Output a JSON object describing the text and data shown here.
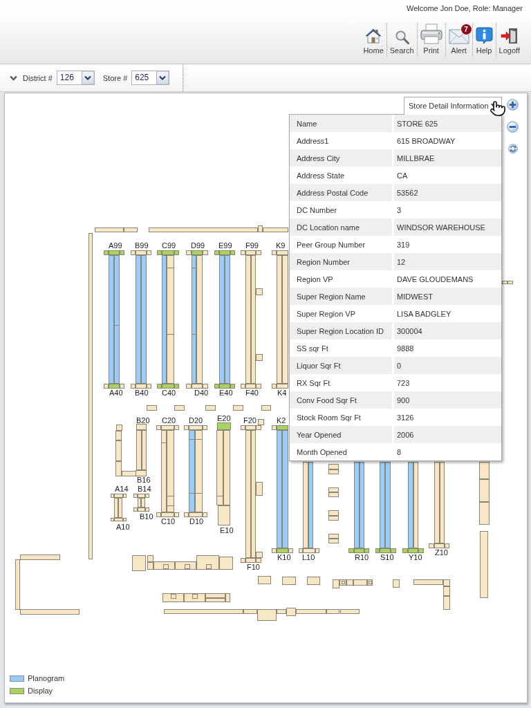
{
  "header": {
    "welcome": "Welcome Jon Doe, Role: Manager"
  },
  "toolbar": [
    {
      "kind": "home",
      "label": "Home"
    },
    {
      "kind": "search",
      "label": "Search"
    },
    {
      "kind": "print",
      "label": "Print"
    },
    {
      "kind": "alert",
      "label": "Alert",
      "badge": "7"
    },
    {
      "kind": "help",
      "label": "Help"
    },
    {
      "kind": "logoff",
      "label": "Logoff"
    }
  ],
  "filters": [
    {
      "label": "District #",
      "value": "126"
    },
    {
      "label": "Store #",
      "value": "625"
    }
  ],
  "details": {
    "tab": "Store Detail Information",
    "rows": [
      {
        "label": "Name",
        "value": "STORE 625"
      },
      {
        "label": "Address1",
        "value": "615 BROADWAY"
      },
      {
        "label": "Address City",
        "value": "MILLBRAE"
      },
      {
        "label": "Address State",
        "value": "CA"
      },
      {
        "label": "Address Postal Code",
        "value": "53562"
      },
      {
        "label": "DC Number",
        "value": "3"
      },
      {
        "label": "DC Location name",
        "value": "WINDSOR WAREHOUSE"
      },
      {
        "label": "Peer Group Number",
        "value": "319"
      },
      {
        "label": "Region Number",
        "value": "12"
      },
      {
        "label": "Region VP",
        "value": "DAVE GLOUDEMANS"
      },
      {
        "label": "Super Region Name",
        "value": "MIDWEST"
      },
      {
        "label": "Super Region VP",
        "value": "LISA BADGLEY"
      },
      {
        "label": "Super Region Location ID",
        "value": "300004"
      },
      {
        "label": "SS sqr Ft",
        "value": "9888"
      },
      {
        "label": "Liquor Sqr Ft",
        "value": "0"
      },
      {
        "label": "RX Sqr Ft",
        "value": "723"
      },
      {
        "label": "Conv Food Sqr Ft",
        "value": "900"
      },
      {
        "label": "Stock Room Sqr Ft",
        "value": "3126"
      },
      {
        "label": "Year Opened",
        "value": "2006"
      },
      {
        "label": "Month Opened",
        "value": "8"
      }
    ]
  },
  "floor_plan": {
    "aisles": [
      {
        "top_label": "A99",
        "bottom_label": "A40",
        "top_cap": [
          {
            "kind": "display"
          },
          {
            "kind": "display"
          },
          {
            "kind": "display"
          }
        ],
        "shelves": [
          {
            "kind": "planogram"
          },
          {
            "kind": "planogram"
          }
        ],
        "bottom_cap": [
          {
            "kind": "plain"
          },
          {
            "kind": "display"
          },
          {
            "kind": "plain"
          }
        ]
      },
      {
        "top_label": "B99",
        "bottom_label": "B40",
        "top_cap": [
          {
            "kind": "plain"
          },
          {
            "kind": "plain"
          },
          {
            "kind": "plain"
          }
        ],
        "shelves": [
          {
            "kind": "planogram"
          },
          {
            "kind": "planogram"
          }
        ],
        "bottom_cap": [
          {
            "kind": "plain"
          },
          {
            "kind": "plain"
          },
          {
            "kind": "plain"
          }
        ]
      },
      {
        "top_label": "C99",
        "bottom_label": "C40",
        "top_cap": [
          {
            "kind": "display"
          },
          {
            "kind": "display"
          },
          {
            "kind": "display"
          }
        ],
        "shelves": [
          {
            "kind": "planogram"
          },
          {
            "kind": "plain"
          }
        ],
        "bottom_cap": [
          {
            "kind": "display"
          },
          {
            "kind": "display"
          },
          {
            "kind": "display"
          }
        ]
      },
      {
        "top_label": "D99",
        "bottom_label": "D40",
        "top_cap": [
          {
            "kind": "plain"
          },
          {
            "kind": "display"
          },
          {
            "kind": "plain"
          }
        ],
        "shelves": [
          {
            "kind": "planogram"
          },
          {
            "kind": "plain"
          }
        ],
        "bottom_cap": [
          {
            "kind": "plain"
          },
          {
            "kind": "plain"
          },
          {
            "kind": "plain"
          }
        ]
      },
      {
        "top_label": "E99",
        "bottom_label": "E40",
        "top_cap": [
          {
            "kind": "display"
          },
          {
            "kind": "display"
          },
          {
            "kind": "display"
          }
        ],
        "shelves": [
          {
            "kind": "planogram"
          },
          {
            "kind": "planogram"
          }
        ],
        "bottom_cap": [
          {
            "kind": "display"
          },
          {
            "kind": "display"
          },
          {
            "kind": "display"
          }
        ]
      },
      {
        "top_label": "F99",
        "bottom_label": "F40",
        "top_cap": [
          {
            "kind": "plain"
          },
          {
            "kind": "plain"
          },
          {
            "kind": "plain"
          }
        ],
        "shelves": [
          {
            "kind": "plain"
          },
          {
            "kind": "plain"
          }
        ],
        "bottom_cap": [
          {
            "kind": "plain"
          },
          {
            "kind": "plain"
          },
          {
            "kind": "plain"
          }
        ]
      },
      {
        "top_label": "K9",
        "bottom_label": "K4",
        "top_cap": [
          {
            "kind": "plain"
          },
          {
            "kind": "plain"
          }
        ],
        "shelves": [
          {
            "kind": "plain"
          },
          {
            "kind": "plain"
          }
        ],
        "bottom_cap": [
          {
            "kind": "plain"
          },
          {
            "kind": "plain"
          }
        ]
      },
      {
        "top_label": "B20",
        "bottom_label": "B16",
        "top_cap": [
          {
            "kind": "plain"
          }
        ],
        "shelves": [
          {
            "kind": "plain"
          },
          {
            "kind": "plain"
          }
        ],
        "bottom_cap": [
          {
            "kind": "plain"
          }
        ]
      },
      {
        "top_label": "A14",
        "bottom_label": "A10",
        "top_cap": [
          {
            "kind": "plain"
          },
          {
            "kind": "plain"
          },
          {
            "kind": "plain"
          }
        ],
        "shelves": [
          {
            "kind": "plain"
          },
          {
            "kind": "plain"
          }
        ],
        "bottom_cap": [
          {
            "kind": "plain"
          },
          {
            "kind": "plain"
          },
          {
            "kind": "plain"
          }
        ]
      },
      {
        "top_label": "B14",
        "bottom_label": "B10",
        "top_cap": [
          {
            "kind": "plain"
          },
          {
            "kind": "plain"
          },
          {
            "kind": "plain"
          }
        ],
        "shelves": [
          {
            "kind": "plain"
          },
          {
            "kind": "plain"
          }
        ],
        "bottom_cap": [
          {
            "kind": "plain"
          },
          {
            "kind": "plain"
          },
          {
            "kind": "plain"
          }
        ]
      },
      {
        "top_label": "C20",
        "bottom_label": "C10",
        "top_cap": [
          {
            "kind": "plain"
          },
          {
            "kind": "plain"
          },
          {
            "kind": "plain"
          }
        ],
        "shelves": [
          {
            "kind": "plain"
          },
          {
            "kind": "plain"
          }
        ],
        "bottom_cap": [
          {
            "kind": "plain"
          },
          {
            "kind": "plain"
          },
          {
            "kind": "plain"
          }
        ]
      },
      {
        "top_label": "D20",
        "bottom_label": "D10",
        "top_cap": [
          {
            "kind": "plain"
          },
          {
            "kind": "plain"
          },
          {
            "kind": "plain"
          }
        ],
        "shelves": [
          {
            "kind": "planogram"
          },
          {
            "kind": "plain"
          }
        ],
        "bottom_cap": [
          {
            "kind": "plain"
          },
          {
            "kind": "plain"
          },
          {
            "kind": "plain"
          }
        ]
      },
      {
        "top_label": "E20",
        "bottom_label": "E10",
        "top_cap": [
          {
            "kind": "display"
          }
        ],
        "shelves": [
          {
            "kind": "plain"
          },
          {
            "kind": "plain"
          }
        ],
        "bottom_cap": [
          {
            "kind": "plain"
          }
        ]
      },
      {
        "top_label": "F20",
        "bottom_label": "F10",
        "top_cap": [
          {
            "kind": "plain"
          },
          {
            "kind": "plain"
          },
          {
            "kind": "plain"
          }
        ],
        "shelves": [
          {
            "kind": "plain"
          },
          {
            "kind": "plain"
          }
        ],
        "bottom_cap": [
          {
            "kind": "plain"
          },
          {
            "kind": "plain"
          },
          {
            "kind": "plain"
          }
        ]
      },
      {
        "top_label": "K2",
        "bottom_label": "K10",
        "top_cap": [
          {
            "kind": "plain"
          },
          {
            "kind": "display"
          }
        ],
        "shelves": [
          {
            "kind": "planogram"
          },
          {
            "kind": "planogram"
          }
        ],
        "bottom_cap": [
          {
            "kind": "plain"
          },
          {
            "kind": "display"
          },
          {
            "kind": "plain"
          }
        ]
      },
      {
        "bottom_label": "L10",
        "shelves": [
          {
            "kind": "plain"
          },
          {
            "kind": "planogram"
          }
        ],
        "bottom_cap": [
          {
            "kind": "plain"
          },
          {
            "kind": "plain"
          },
          {
            "kind": "plain"
          }
        ]
      },
      {
        "bottom_label": "R10",
        "shelves": [
          {
            "kind": "planogram"
          },
          {
            "kind": "planogram"
          }
        ],
        "bottom_cap": [
          {
            "kind": "display"
          },
          {
            "kind": "display"
          },
          {
            "kind": "display"
          }
        ]
      },
      {
        "bottom_label": "S10",
        "shelves": [
          {
            "kind": "planogram"
          },
          {
            "kind": "planogram"
          }
        ],
        "bottom_cap": [
          {
            "kind": "display"
          },
          {
            "kind": "display"
          },
          {
            "kind": "display"
          }
        ]
      },
      {
        "bottom_label": "Y10",
        "shelves": [
          {
            "kind": "planogram"
          },
          {
            "kind": "plain"
          }
        ],
        "bottom_cap": [
          {
            "kind": "display"
          },
          {
            "kind": "display"
          },
          {
            "kind": "display"
          }
        ]
      },
      {
        "bottom_label": "Z10",
        "shelves": [
          {
            "kind": "plain"
          },
          {
            "kind": "plain"
          }
        ],
        "bottom_cap": [
          {
            "kind": "plain"
          },
          {
            "kind": "plain"
          },
          {
            "kind": "plain"
          }
        ]
      }
    ]
  },
  "legend": [
    {
      "kind": "planogram",
      "label": "Planogram",
      "color": "#99ccff"
    },
    {
      "kind": "display",
      "label": "Display",
      "color": "#a8d35c"
    }
  ]
}
